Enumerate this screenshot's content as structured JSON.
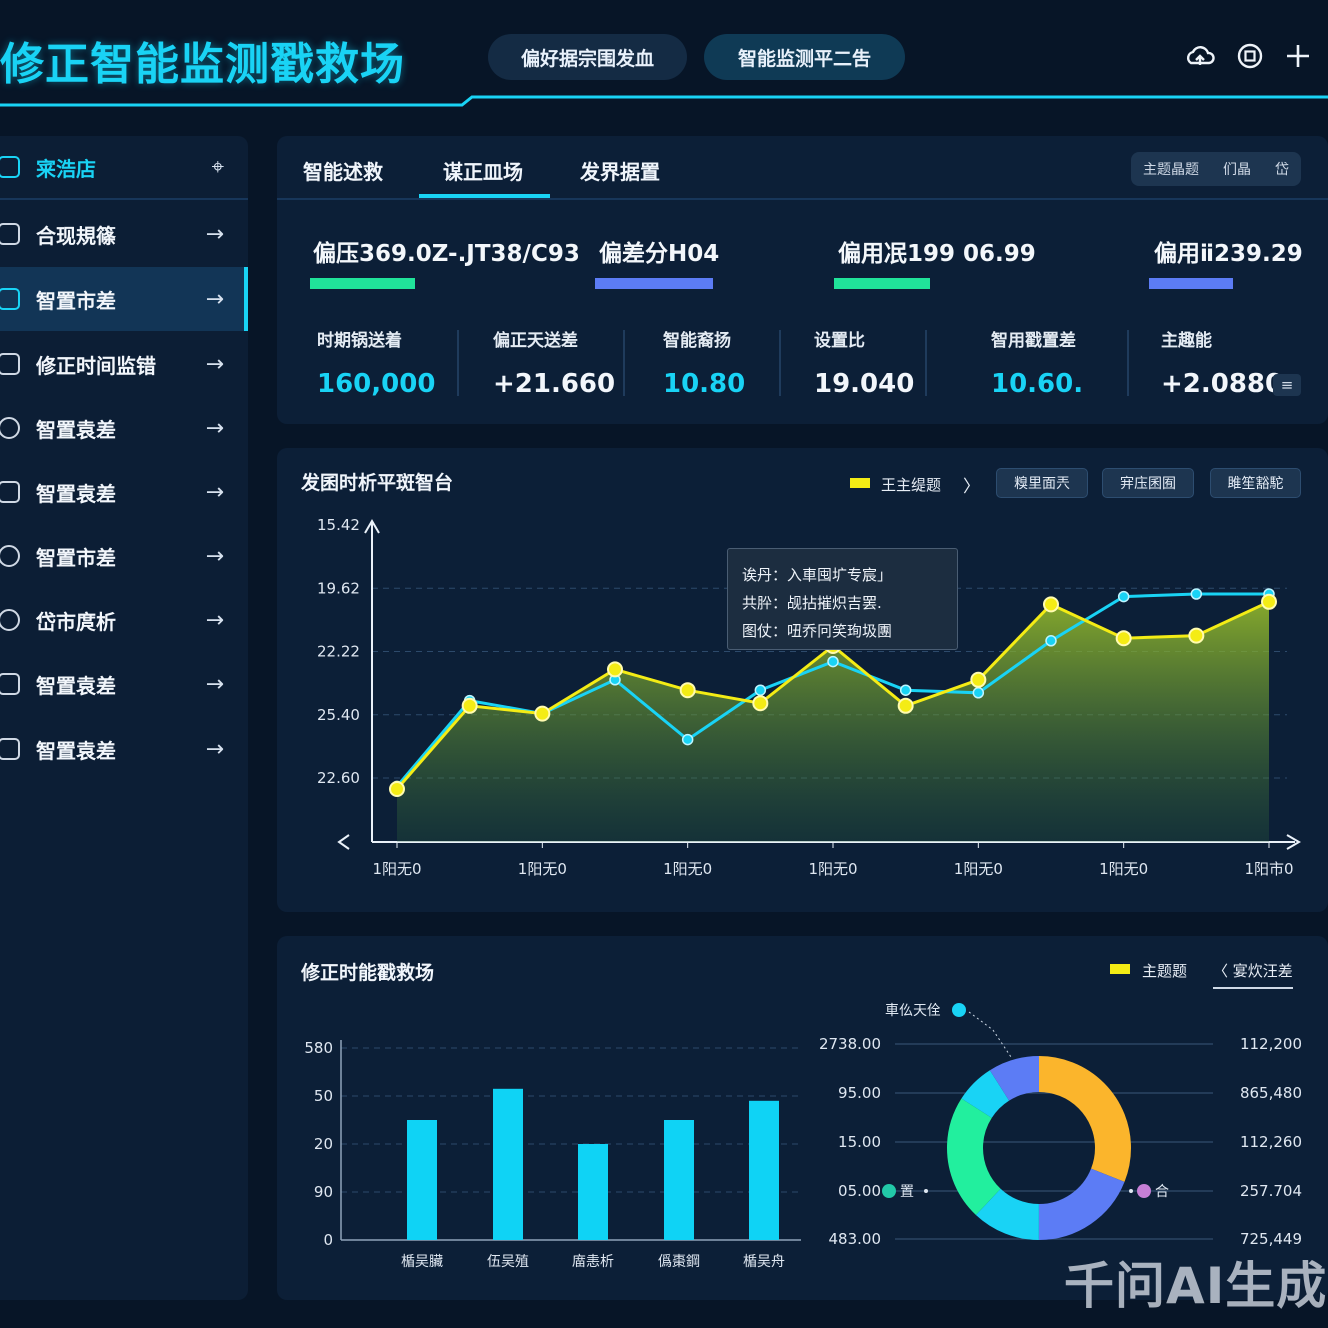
{
  "header": {
    "title": "修正智能监测戳救场",
    "pill_a": "偏好据宗围发血",
    "pill_b": "智能监测平二吿",
    "icons": [
      "cloud-upload-icon",
      "stop-icon",
      "plus-icon"
    ]
  },
  "sidebar": {
    "items": [
      {
        "label": "宷浩店",
        "icon": "folder-icon"
      },
      {
        "label": "合现規篠",
        "icon": "grid-icon"
      },
      {
        "label": "智置市差",
        "icon": "layout-icon"
      },
      {
        "label": "修正时间监错",
        "icon": "monitor-icon"
      },
      {
        "label": "智置袁差",
        "icon": "refresh-icon"
      },
      {
        "label": "智置袁差",
        "icon": "image-icon"
      },
      {
        "label": "智置市差",
        "icon": "sync-icon"
      },
      {
        "label": "岱市庹析",
        "icon": "clock-icon"
      },
      {
        "label": "智置袁差",
        "icon": "document-icon"
      },
      {
        "label": "智置袁差",
        "icon": "window-icon"
      }
    ]
  },
  "overview": {
    "tabs": [
      "智能述救",
      "谋正皿场",
      "发界据置"
    ],
    "theme_switch": [
      "主题晶题",
      "们晶",
      "岱"
    ],
    "kpis": [
      {
        "label": "偏压369.0Z-.J⁠T38/C93",
        "color": "#20e39a"
      },
      {
        "label": "偏差分H04",
        "color": "#5c7cf5"
      },
      {
        "label": "偏用冺199 06.99",
        "color": "#20e39a"
      },
      {
        "label": "偏用ⅱ239.29",
        "color": "#5c7cf5"
      }
    ],
    "stats": [
      {
        "label": "时期锅送着",
        "value": "160,000",
        "color": "#19d3f5"
      },
      {
        "label": "偏正天送差",
        "value": "+21.660",
        "color": "#f2f6fb"
      },
      {
        "label": "智能裔扬",
        "value": "10.80",
        "color": "#19d3f5"
      },
      {
        "label": "设置比",
        "value": "19.040",
        "color": "#f2f6fb"
      },
      {
        "label": "智用戳置差",
        "value": "10.60.",
        "color": "#19d3f5"
      },
      {
        "label": "主趣能",
        "value": "+2.0880",
        "color": "#f2f6fb"
      }
    ],
    "menu_icon": "menu-icon"
  },
  "line_panel": {
    "title": "发囷时析平斑智台",
    "legend": "王主缇题",
    "buttons": [
      "糗里面兲",
      "宑庒囷囿",
      "雎笙豁駝"
    ],
    "tooltip": [
      "诶丹：入車囤圹专宸」",
      "共肸：觇拈摧炽吉罢.",
      "图仗：吜乔冋笑珣圾團"
    ]
  },
  "bottom_panel": {
    "title": "修正时能戳救场",
    "legend": "主题题",
    "filter": "〈 宴炊汪差",
    "donut_labels": [
      "車仫天佺",
      "置",
      "合"
    ]
  },
  "watermark": "千问AI生成",
  "chart_data": [
    {
      "type": "line",
      "title": "发囷时析平斑智台",
      "y_tick_labels": [
        "15.42",
        "19.62",
        "22.22",
        "25.40",
        "22.60"
      ],
      "x_tick_labels": [
        "1阳无0",
        "1阳无0",
        "1阳无0",
        "1阳无0",
        "1阳无0",
        "1阳无0",
        "1阳市0"
      ],
      "series": [
        {
          "name": "王主缇题",
          "color": "#f4ec15",
          "values": [
            0.15,
            0.47,
            0.44,
            0.61,
            0.53,
            0.48,
            0.7,
            0.47,
            0.57,
            0.86,
            0.73,
            0.74,
            0.87
          ]
        },
        {
          "color": "#19d3f5",
          "values": [
            0.16,
            0.49,
            0.44,
            0.57,
            0.34,
            0.53,
            0.64,
            0.53,
            0.52,
            0.72,
            0.89,
            0.9,
            0.9
          ]
        }
      ],
      "grid": true
    },
    {
      "type": "bar",
      "categories": [
        "楯吴臟",
        "伍吴殖",
        "庿恚析",
        "僞棗鋼",
        "楯吴舟"
      ],
      "values": [
        50,
        63,
        40,
        50,
        58
      ],
      "y_tick_labels": [
        "0",
        "90",
        "20",
        "50",
        "580"
      ],
      "ylim": [
        0,
        80
      ],
      "color": "#0fd3f5",
      "grid": true
    },
    {
      "type": "pie",
      "donut": true,
      "left_labels": [
        "2738.00",
        "95.00",
        "15.00",
        "05.00",
        "483.00"
      ],
      "right_labels": [
        "112,200",
        "865,480",
        "112,260",
        "257.704",
        "725,449"
      ],
      "segments": [
        {
          "color": "#fbb52c",
          "value": 31
        },
        {
          "color": "#5c7cf5",
          "value": 19
        },
        {
          "color": "#19d3f5",
          "value": 12
        },
        {
          "color": "#22ef9e",
          "value": 22
        },
        {
          "color": "#19d3f5",
          "value": 7
        },
        {
          "color": "#5c7cf5",
          "value": 9
        }
      ]
    }
  ]
}
